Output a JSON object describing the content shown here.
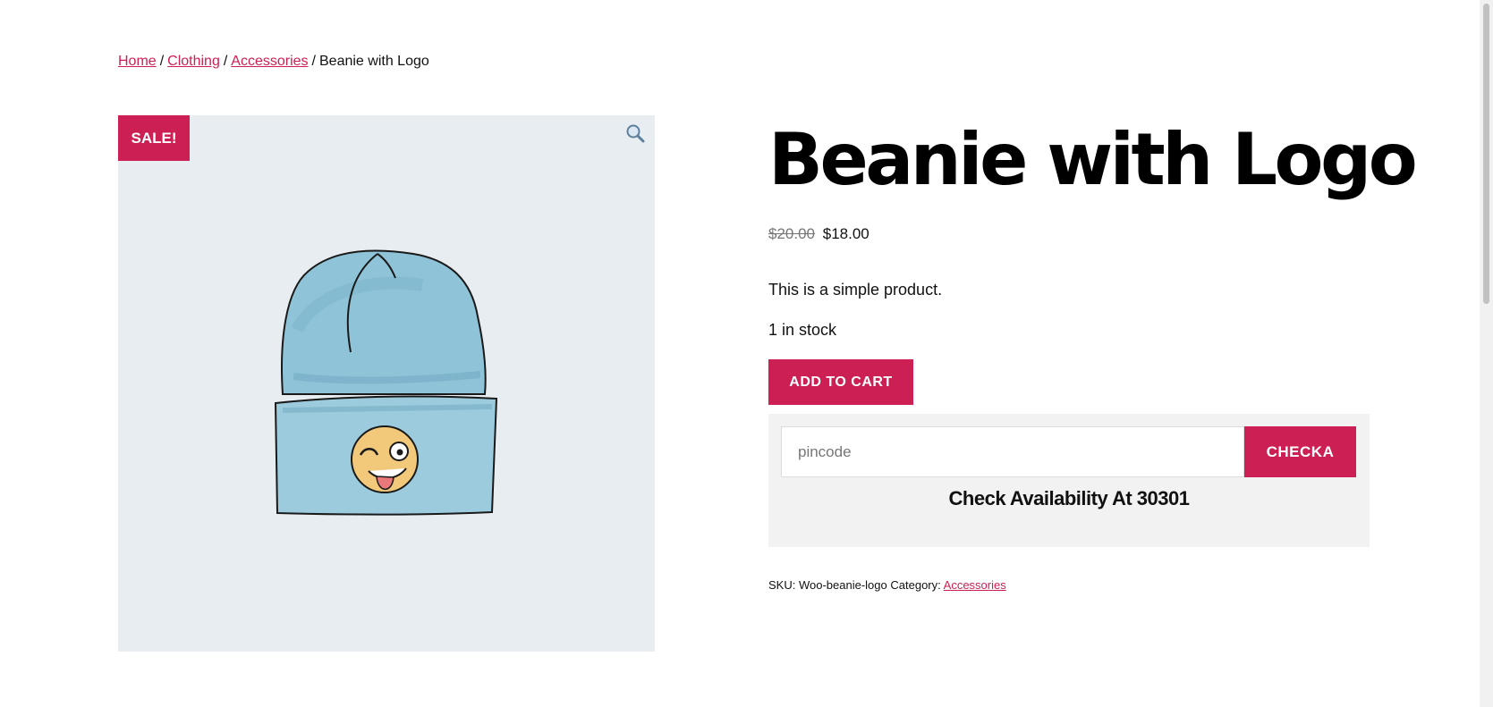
{
  "breadcrumb": {
    "items": [
      {
        "label": "Home"
      },
      {
        "label": "Clothing"
      },
      {
        "label": "Accessories"
      }
    ],
    "separator": "/",
    "current": "Beanie with Logo"
  },
  "gallery": {
    "badge": "SALE!",
    "zoom_icon": "magnifier-icon",
    "image_subject": "light blue beanie with winking emoji patch"
  },
  "product": {
    "title": "Beanie with Logo",
    "price_old": "$20.00",
    "price_new": "$18.00",
    "short_description": "This is a simple product.",
    "stock": "1 in stock",
    "add_to_cart_label": "ADD TO CART"
  },
  "pincode": {
    "placeholder": "pincode",
    "value": "",
    "button_label": "CHECKA",
    "availability_text": "Check Availability At 30301"
  },
  "meta": {
    "sku_label": "SKU:",
    "sku_value": "Woo-beanie-logo",
    "category_label": "Category:",
    "category_value": "Accessories"
  },
  "colors": {
    "accent": "#cc1f53",
    "image_bg": "#e7edf1",
    "pincode_box_bg": "#f2f2f2"
  }
}
